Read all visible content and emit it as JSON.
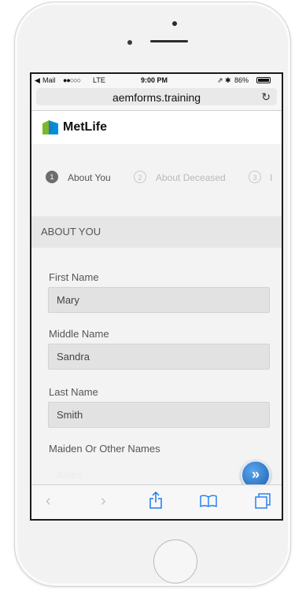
{
  "status": {
    "carrier": "Mail",
    "signal": "●●○○○",
    "network": "LTE",
    "time": "9:00 PM",
    "icons": "⇗ ✱",
    "battery_percent": "86%"
  },
  "browser": {
    "url": "aemforms.training",
    "reload_icon": "↻"
  },
  "brand": {
    "name": "MetLife"
  },
  "steps": [
    {
      "number": "1",
      "label": "About You",
      "state": "active"
    },
    {
      "number": "2",
      "label": "About Deceased",
      "state": "inactive"
    },
    {
      "number": "3",
      "label": "I",
      "state": "inactive"
    }
  ],
  "section": {
    "title": "ABOUT YOU"
  },
  "fields": {
    "first_name": {
      "label": "First Name",
      "value": "Mary"
    },
    "middle_name": {
      "label": "Middle Name",
      "value": "Sandra"
    },
    "last_name": {
      "label": "Last Name",
      "value": "Smith"
    },
    "maiden_name": {
      "label": "Maiden Or Other Names",
      "value": "Jones"
    }
  },
  "colors": {
    "brand_green": "#7ab929",
    "brand_blue": "#0090da",
    "fab_blue": "#1c5fb0"
  }
}
